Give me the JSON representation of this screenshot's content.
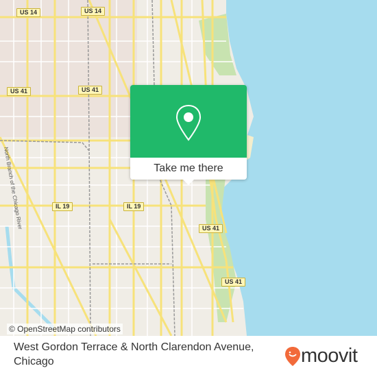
{
  "map": {
    "route_shields": [
      "US 14",
      "US 14",
      "US 41",
      "US 41",
      "IL 19",
      "IL 19",
      "US 41",
      "US 41"
    ],
    "river_label": "North Branch of the Chicago River",
    "attribution": "© OpenStreetMap contributors",
    "colors": {
      "water": "#a6dcee",
      "land": "#f0ede6",
      "park": "#c8e3b0",
      "major_road": "#f7e27a",
      "rail": "#999999"
    }
  },
  "popup": {
    "icon": "map-pin-icon",
    "button_label": "Take me there",
    "color": "#20b96a"
  },
  "footer": {
    "address": "West Gordon Terrace & North Clarendon Avenue, Chicago",
    "brand": "moovit",
    "brand_color": "#f26a3a"
  }
}
